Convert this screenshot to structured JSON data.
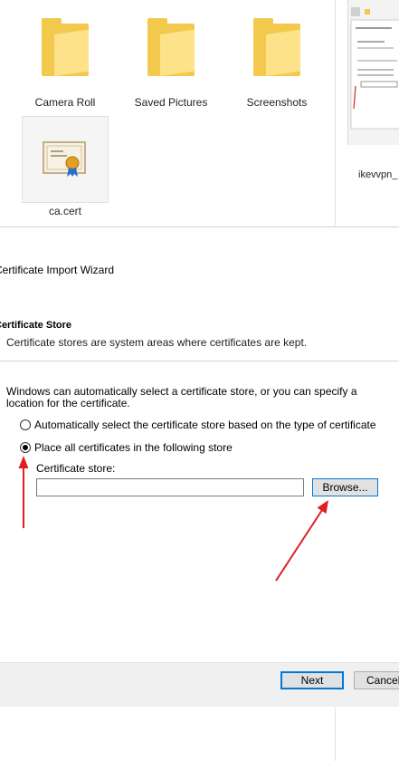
{
  "explorer": {
    "folders": [
      {
        "label": "Camera Roll"
      },
      {
        "label": "Saved Pictures"
      },
      {
        "label": "Screenshots"
      }
    ],
    "file": {
      "label": "ca.cert",
      "icon": "certificate-icon"
    },
    "thumbnail": {
      "label": "ikevvpn_"
    }
  },
  "wizard": {
    "title": "Certificate Import Wizard",
    "section_title": "Certificate Store",
    "section_subtitle": "Certificate stores are system areas where certificates are kept.",
    "description": "Windows can automatically select a certificate store, or you can specify a location for the certificate.",
    "options": [
      {
        "label": "Automatically select the certificate store based on the type of certificate",
        "selected": false
      },
      {
        "label": "Place all certificates in the following store",
        "selected": true
      }
    ],
    "store_label": "Certificate store:",
    "store_value": "",
    "browse_label": "Browse...",
    "next_label": "Next",
    "cancel_label": "Cancel"
  },
  "colors": {
    "accent": "#0078d7",
    "annotation": "#e02020",
    "folder": "#f2c94c"
  }
}
